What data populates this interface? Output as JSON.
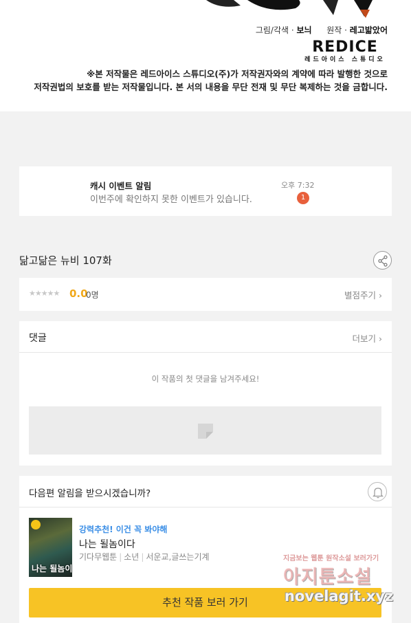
{
  "credits": {
    "art_label": "그림/각색 ·",
    "art_name": "보늬",
    "origin_label": "원작 ·",
    "origin_name": "레고밟았어"
  },
  "studio_logo": {
    "word": "REDICE",
    "sub": "레드아이스 스튜디오"
  },
  "copyright_notice": {
    "line1": "※본 저작물은 레드아이스 스튜디오(주)가 저작권자와의 계약에 따라 발행한 것으로",
    "line2": "저작권법의 보호를 받는 저작물입니다. 본 서의 내용을 무단 전재 및 무단 복제하는 것을 금합니다."
  },
  "event_notice": {
    "title": "캐시 이벤트 알림",
    "message": "이번주에 확인하지 못한 이벤트가 있습니다.",
    "time": "오후 7:32",
    "badge": "1"
  },
  "episode": {
    "title": "닮고닮은 뉴비 107화",
    "share_icon": "share-icon"
  },
  "rating": {
    "stars": "★★★★★",
    "stars_filled": 0,
    "score": "0.0",
    "count": "0명",
    "rate_label": "별점주기 ›"
  },
  "comments": {
    "title": "댓글",
    "more_label": "더보기 ›",
    "empty_text": "이 작품의 첫 댓글을 남겨주세요!"
  },
  "recommend": {
    "question": "다음편 알림을 받으시겠습니까?",
    "bell_icon": "bell-icon",
    "tag": "강력추천! 이건 꼭 봐야해",
    "name": "나는 될놈이다",
    "thumb_title": "나는 될놈이다",
    "meta_genre": "기다무웹툰",
    "meta_category": "소년",
    "meta_authors": "서운교,글쓰는기계",
    "button_label": "추천 작품 보러 가기"
  },
  "watermark": {
    "line1": "지금보는 웹툰 원작소설 보러가기",
    "line2": "아지툰소설",
    "url": "novelagit.xyz"
  },
  "colors": {
    "accent_yellow": "#f7c325",
    "score_orange": "#f0a81a",
    "badge_red": "#e8603c",
    "tag_blue": "#3a8ee6",
    "page_bg": "#f2f2f2"
  }
}
